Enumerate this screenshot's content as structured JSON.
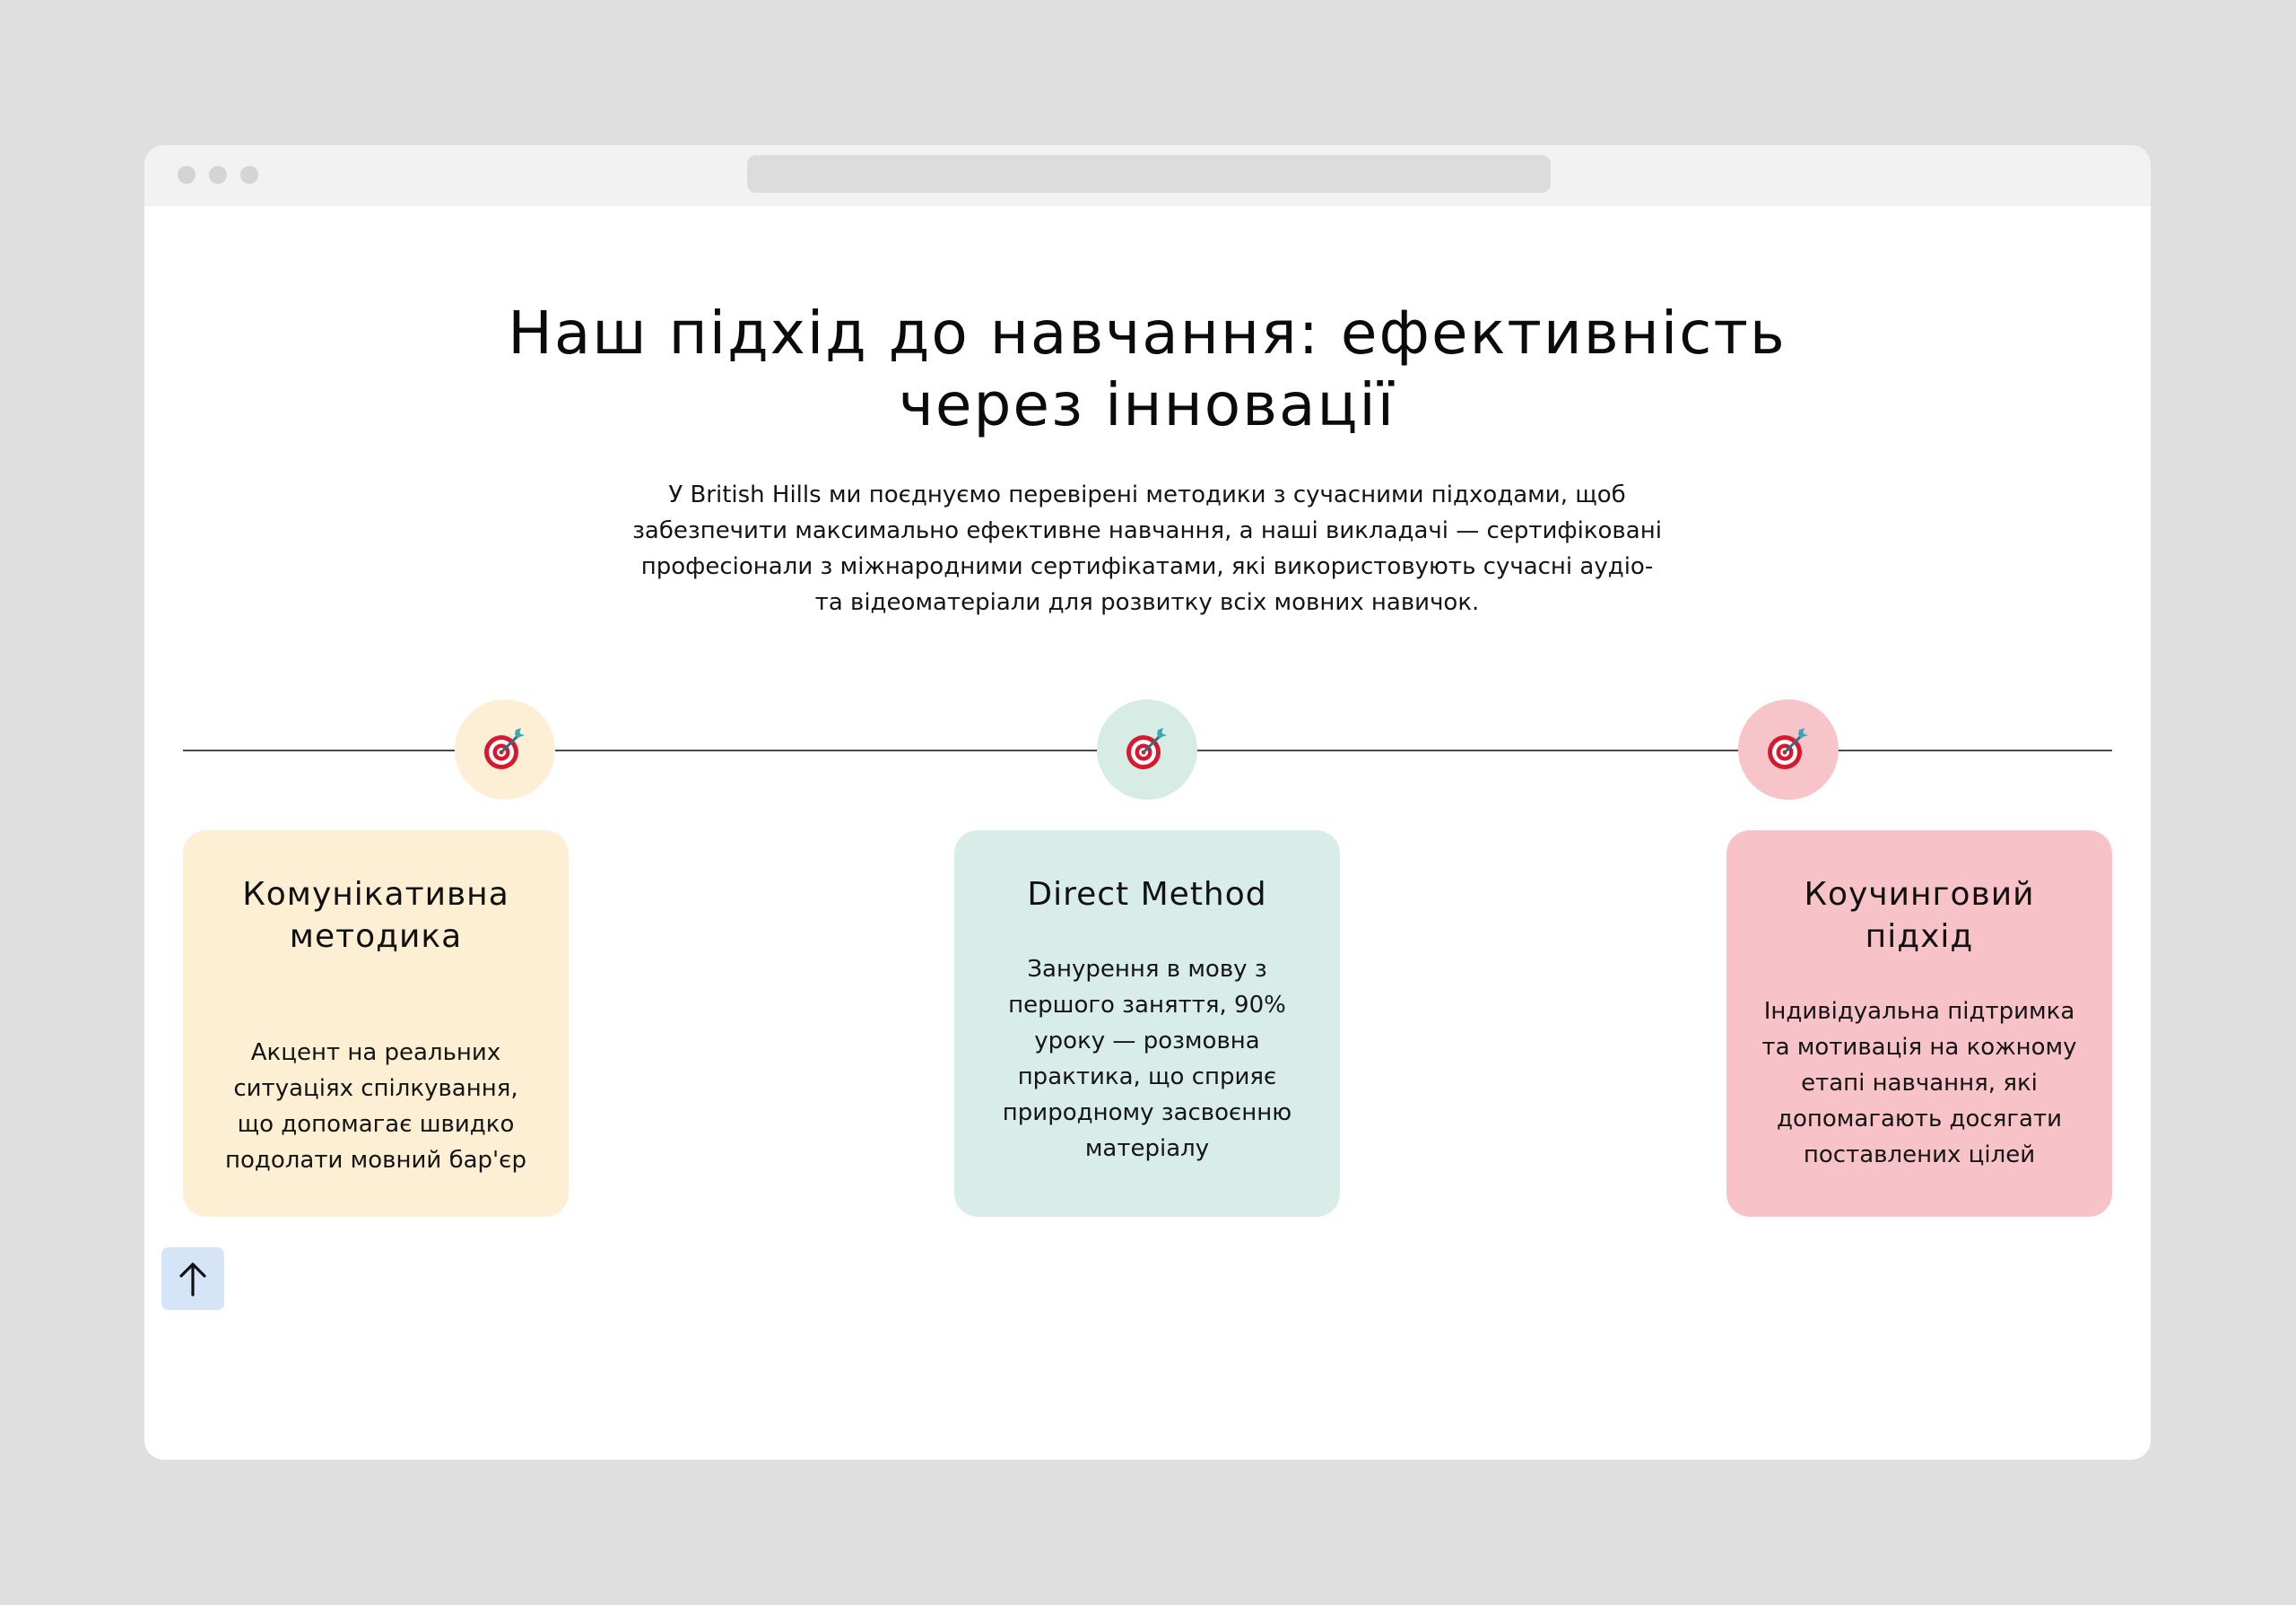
{
  "section": {
    "title": "Наш підхід до навчання: ефективність через інновації",
    "description": "У British Hills ми поєднуємо перевірені методики з сучасними підходами, щоб забезпечити максимально ефективне навчання, а наші викладачі — сертифіковані професіонали з міжнародними сертифікатами, які використовують сучасні аудіо- та відеоматеріали для розвитку всіх мовних навичок."
  },
  "timeline": {
    "markers": [
      {
        "icon": "target-icon",
        "color": "#fcefd6"
      },
      {
        "icon": "target-icon",
        "color": "#d8ece6"
      },
      {
        "icon": "target-icon",
        "color": "#f7c4ca"
      }
    ]
  },
  "cards": [
    {
      "title": "Комунікативна методика",
      "text": "Акцент на реальних ситуаціях спілкування, що допомагає швидко подолати мовний бар'єр",
      "color": "#fdefd3"
    },
    {
      "title": "Direct Method",
      "text": "Занурення в мову з першого заняття, 90% уроку — розмовна практика, що сприяє природному засвоєнню матеріалу",
      "color": "#d8ede7"
    },
    {
      "title": "Коучинговий підхід",
      "text": "Індивідуальна підтримка та мотивація на кожному етапі навчання, які допомагають досягати поставлених цілей",
      "color": "#f7c3c9"
    }
  ],
  "scroll_top": {
    "icon": "arrow-up-icon"
  }
}
